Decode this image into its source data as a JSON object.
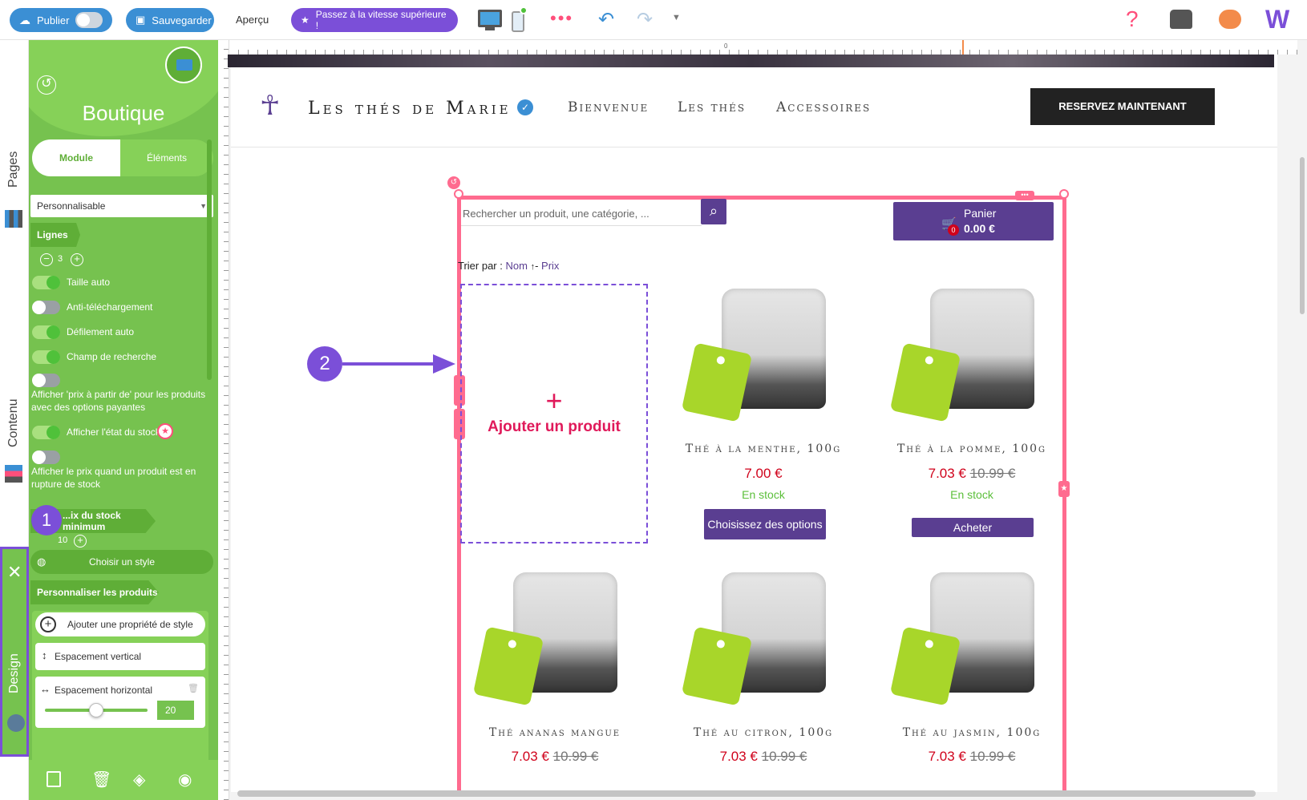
{
  "toolbar": {
    "publish_label": "Publier",
    "save_label": "Sauvegarder",
    "preview_label": "Aperçu",
    "upgrade_label": "Passez à la vitesse supérieure !",
    "colors": {
      "blue": "#3b8fd4",
      "purple": "#7b4fd8"
    }
  },
  "rail": {
    "pages_label": "Pages",
    "content_label": "Contenu",
    "design_label": "Design"
  },
  "panel": {
    "title": "Boutique",
    "tabs": [
      "Module",
      "Éléments"
    ],
    "select_value": "Personnalisable",
    "rows_label": "Lignes",
    "rows_value": "3",
    "toggles": [
      {
        "label": "Taille auto",
        "on": true
      },
      {
        "label": "Anti-téléchargement",
        "on": false
      },
      {
        "label": "Défilement auto",
        "on": true
      },
      {
        "label": "Champ de recherche",
        "on": true
      },
      {
        "label": "Afficher 'prix à partir de' pour les produits avec des options payantes",
        "on": false
      },
      {
        "label": "Afficher l'état du stock",
        "on": true
      },
      {
        "label": "Afficher le prix quand un produit est en rupture de stock",
        "on": false
      }
    ],
    "stock_min_label": "Seuil du stock minimum",
    "stock_min_visible": "...ix du stock minimum",
    "stock_min_value": "10",
    "choose_style": "Choisir un style",
    "customize_products": "Personnaliser les produits",
    "add_style_prop": "Ajouter une propriété de style",
    "vertical_spacing": "Espacement vertical",
    "horizontal_spacing": "Espacement horizontal",
    "horizontal_value": "20",
    "horizontal_slider_fraction": 0.5,
    "badge_1": "1"
  },
  "site": {
    "brand": "Les thés de Marie",
    "nav": [
      "Bienvenue",
      "Les thés",
      "Accessoires"
    ],
    "cta": "RESERVEZ MAINTENANT",
    "ruler_zero": "0"
  },
  "shop": {
    "search_placeholder": "Rechercher un produit, une catégorie, ...",
    "cart_label": "Panier",
    "cart_total": "0.00 €",
    "cart_count": "0",
    "sort_label": "Trier par :",
    "sort_name": "Nom",
    "sort_arrow": "↑",
    "sort_sep": "-",
    "sort_price": "Prix",
    "add_product": "Ajouter un produit",
    "badge_2": "2",
    "products": [
      {
        "title": "Thé à la menthe, 100g",
        "price": "7.00 €",
        "old": "",
        "stock": "En stock",
        "button": "Choisissez des options"
      },
      {
        "title": "Thé à la pomme, 100g",
        "price": "7.03 €",
        "old": "10.99 €",
        "stock": "En stock",
        "button": "Acheter"
      },
      {
        "title": "Thé ananas mangue",
        "price": "7.03 €",
        "old": "10.99 €"
      },
      {
        "title": "Thé au citron, 100g",
        "price": "7.03 €",
        "old": "10.99 €"
      },
      {
        "title": "Thé au jasmin, 100g",
        "price": "7.03 €",
        "old": "10.99 €"
      }
    ]
  }
}
